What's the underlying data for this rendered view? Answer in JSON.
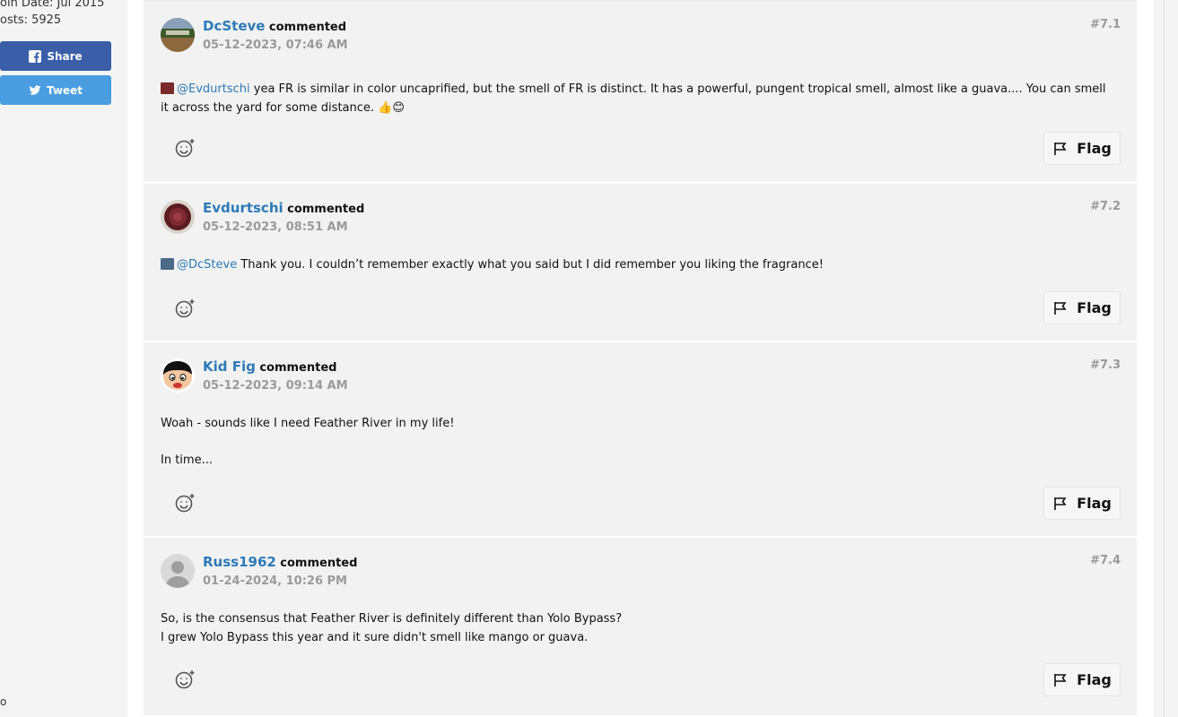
{
  "sidebar": {
    "join_date": "oin Date: Jul 2015",
    "posts": "osts: 5925",
    "share_label": "Share",
    "tweet_label": "Tweet",
    "bottom_mark": "o"
  },
  "colors": {
    "link": "#2d7ab8",
    "facebook": "#3b5ea9",
    "twitter": "#4a9de0",
    "muted": "#9a9a9a",
    "card": "#f2f2f2"
  },
  "comments": [
    {
      "author": "DcSteve",
      "verb": "commented",
      "date": "05-12-2023, 07:46 AM",
      "number": "#7.1",
      "mention": "@Evdurtschi",
      "text": "yea FR is similar in color uncaprified, but the smell of FR is distinct. It has a powerful, pungent tropical smell, almost like a guava.... You can smell it across the yard for some distance. 👍😊",
      "avatar_icon": "dcsteve-avatar",
      "flag_label": "Flag"
    },
    {
      "author": "Evdurtschi",
      "verb": "commented",
      "date": "05-12-2023, 08:51 AM",
      "number": "#7.2",
      "mention": "@DcSteve",
      "text": "Thank you. I couldn’t remember exactly what you said but I did remember you liking the fragrance!",
      "avatar_icon": "evdurtschi-avatar",
      "flag_label": "Flag"
    },
    {
      "author": "Kid Fig",
      "verb": "commented",
      "date": "05-12-2023, 09:14 AM",
      "number": "#7.3",
      "line1": "Woah - sounds like I need Feather River in my life!",
      "line2": "In time...",
      "avatar_icon": "kidfig-avatar",
      "flag_label": "Flag"
    },
    {
      "author": "Russ1962",
      "verb": "commented",
      "date": "01-24-2024, 10:26 PM",
      "number": "#7.4",
      "line1": "So, is the consensus that Feather River is definitely different than Yolo Bypass?",
      "line2": "I grew Yolo Bypass this year and it sure didn't smell like mango or guava.",
      "avatar_icon": "default-user-avatar",
      "flag_label": "Flag"
    }
  ]
}
